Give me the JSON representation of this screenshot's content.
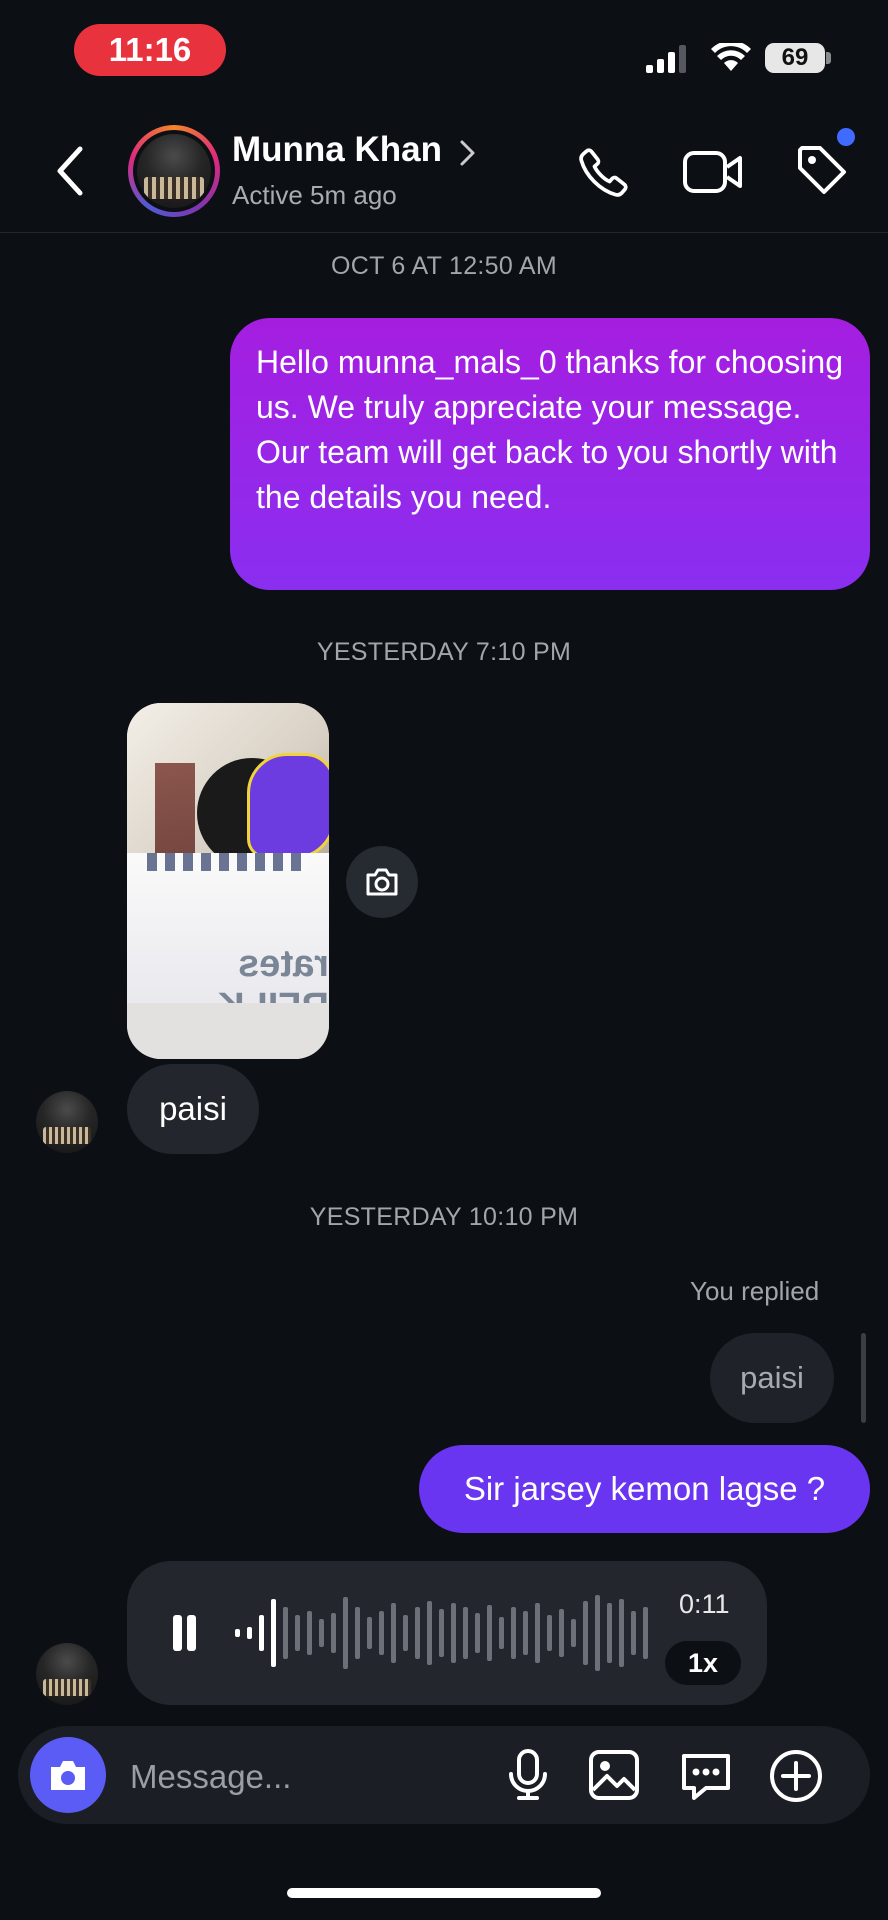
{
  "status_bar": {
    "time": "11:16",
    "battery": "69"
  },
  "header": {
    "name": "Munna Khan",
    "status": "Active 5m ago"
  },
  "messages": {
    "ts1": "OCT 6 AT 12:50 AM",
    "out1": "Hello munna_mals_0 thanks for choosing us. We truly appreciate your message. Our team will get back to you shortly with the details you need.",
    "ts2": "YESTERDAY 7:10 PM",
    "photo_text": "rates RFILK",
    "in1": "paisi",
    "ts3": "YESTERDAY 10:10 PM",
    "replied_label": "You replied",
    "reply_quote": "paisi",
    "out2": "Sir jarsey kemon lagse ?",
    "voice_duration": "0:11",
    "voice_speed": "1x"
  },
  "composer": {
    "placeholder": "Message..."
  },
  "icons": [
    "back-icon",
    "chevron-right-icon",
    "phone-icon",
    "video-icon",
    "tag-icon",
    "camera-icon",
    "pause-icon",
    "mic-icon",
    "image-icon",
    "sticker-icon",
    "plus-icon"
  ],
  "colors": {
    "accent": "#5b5bf5",
    "time_pill": "#e8333f",
    "out_purple": "#a51ee0",
    "out_violet": "#6a35f0",
    "notify_dot": "#3f6bff"
  }
}
